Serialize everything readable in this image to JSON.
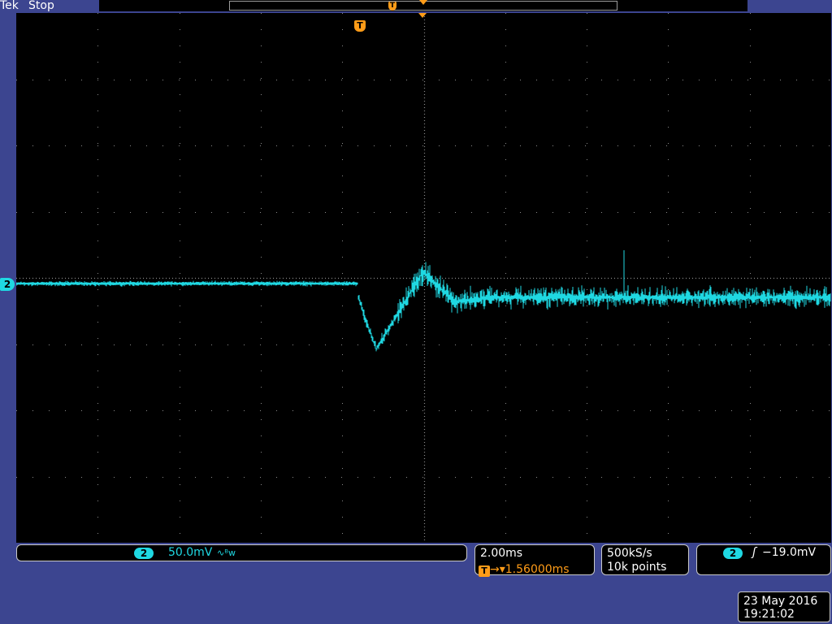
{
  "header": {
    "brand": "Tek",
    "status": "Stop"
  },
  "colors": {
    "background": "#3c4590",
    "channel_2": "#1fd8e2",
    "trigger": "#ff9c18",
    "grid": "#8a8a8a"
  },
  "icons": {
    "trigger_marker": "trigger-T-icon",
    "expansion_point": "orange-triangle-icon"
  },
  "trigger_marker": {
    "label": "T"
  },
  "channel_marker": {
    "label": "2"
  },
  "vertical": {
    "channel": "2",
    "scale": "50.0mV",
    "bandwidth_symbol": "∿ᴮw"
  },
  "horizontal": {
    "scale": "2.00ms",
    "trigger_position": "1.56000ms",
    "trigger_arrow": "→▾"
  },
  "acquisition": {
    "sample_rate": "500kS/s",
    "record_length": "10k points"
  },
  "trigger": {
    "source": "2",
    "slope_symbol": "ʃ",
    "level": "−19.0mV"
  },
  "datetime": {
    "date": "23 May 2016",
    "time": "19:21:02"
  }
}
